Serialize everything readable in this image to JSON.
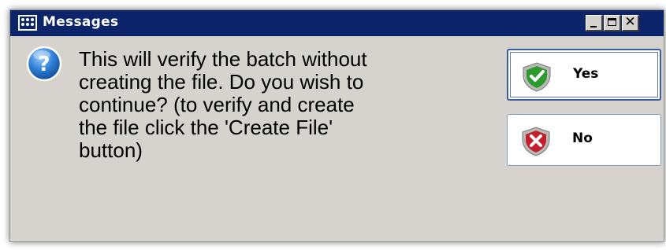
{
  "window": {
    "title": "Messages",
    "icon": "app-dots-icon",
    "controls": [
      "minimize-icon",
      "maximize-icon",
      "close-icon"
    ],
    "close_glyph": "✕"
  },
  "dialog": {
    "icon": "question-icon",
    "message": "This will verify the batch without\ncreating the file. Do you wish to\ncontinue? (to verify and create\nthe file click the 'Create File'\nbutton)"
  },
  "buttons": {
    "yes": {
      "label": "Yes",
      "icon": "check-shield-icon",
      "color": "#2e9a2e"
    },
    "no": {
      "label": "No",
      "icon": "x-shield-icon",
      "color": "#c4202c"
    }
  },
  "colors": {
    "titlebar": "#0b246a",
    "dialog_bg": "#d6d3ce",
    "question_icon": "#2f7fd6"
  }
}
